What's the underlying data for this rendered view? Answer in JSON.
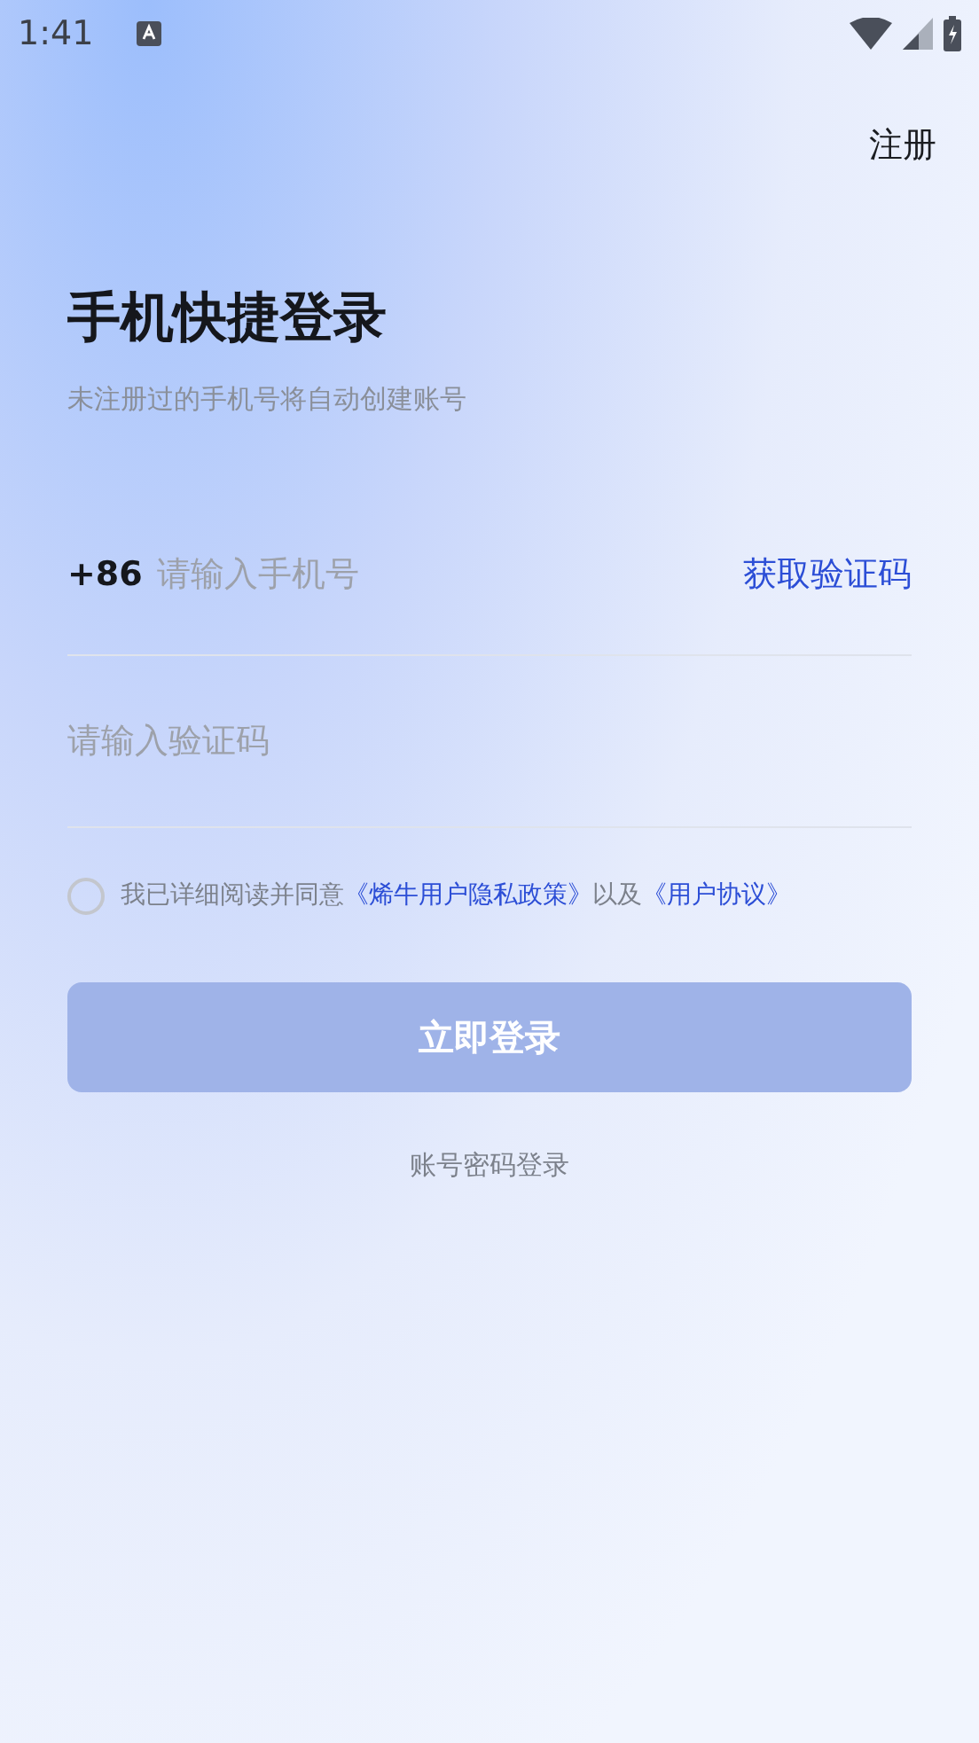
{
  "status_bar": {
    "time": "1:41"
  },
  "top_bar": {
    "register_link": "注册"
  },
  "title": "手机快捷登录",
  "subtitle": "未注册过的手机号将自动创建账号",
  "phone_field": {
    "country_code": "+86",
    "placeholder": "请输入手机号",
    "get_code_button": "获取验证码"
  },
  "code_field": {
    "placeholder": "请输入验证码"
  },
  "agreement": {
    "checked": false,
    "parts": [
      {
        "kind": "text",
        "text": "我已详细阅读并同意"
      },
      {
        "kind": "link",
        "text": "《烯牛用户隐私政策》"
      },
      {
        "kind": "text",
        "text": "以及"
      },
      {
        "kind": "link",
        "text": "《用户协议》"
      }
    ]
  },
  "login_button": {
    "label": "立即登录",
    "disabled": true
  },
  "password_login_link": "账号密码登录"
}
